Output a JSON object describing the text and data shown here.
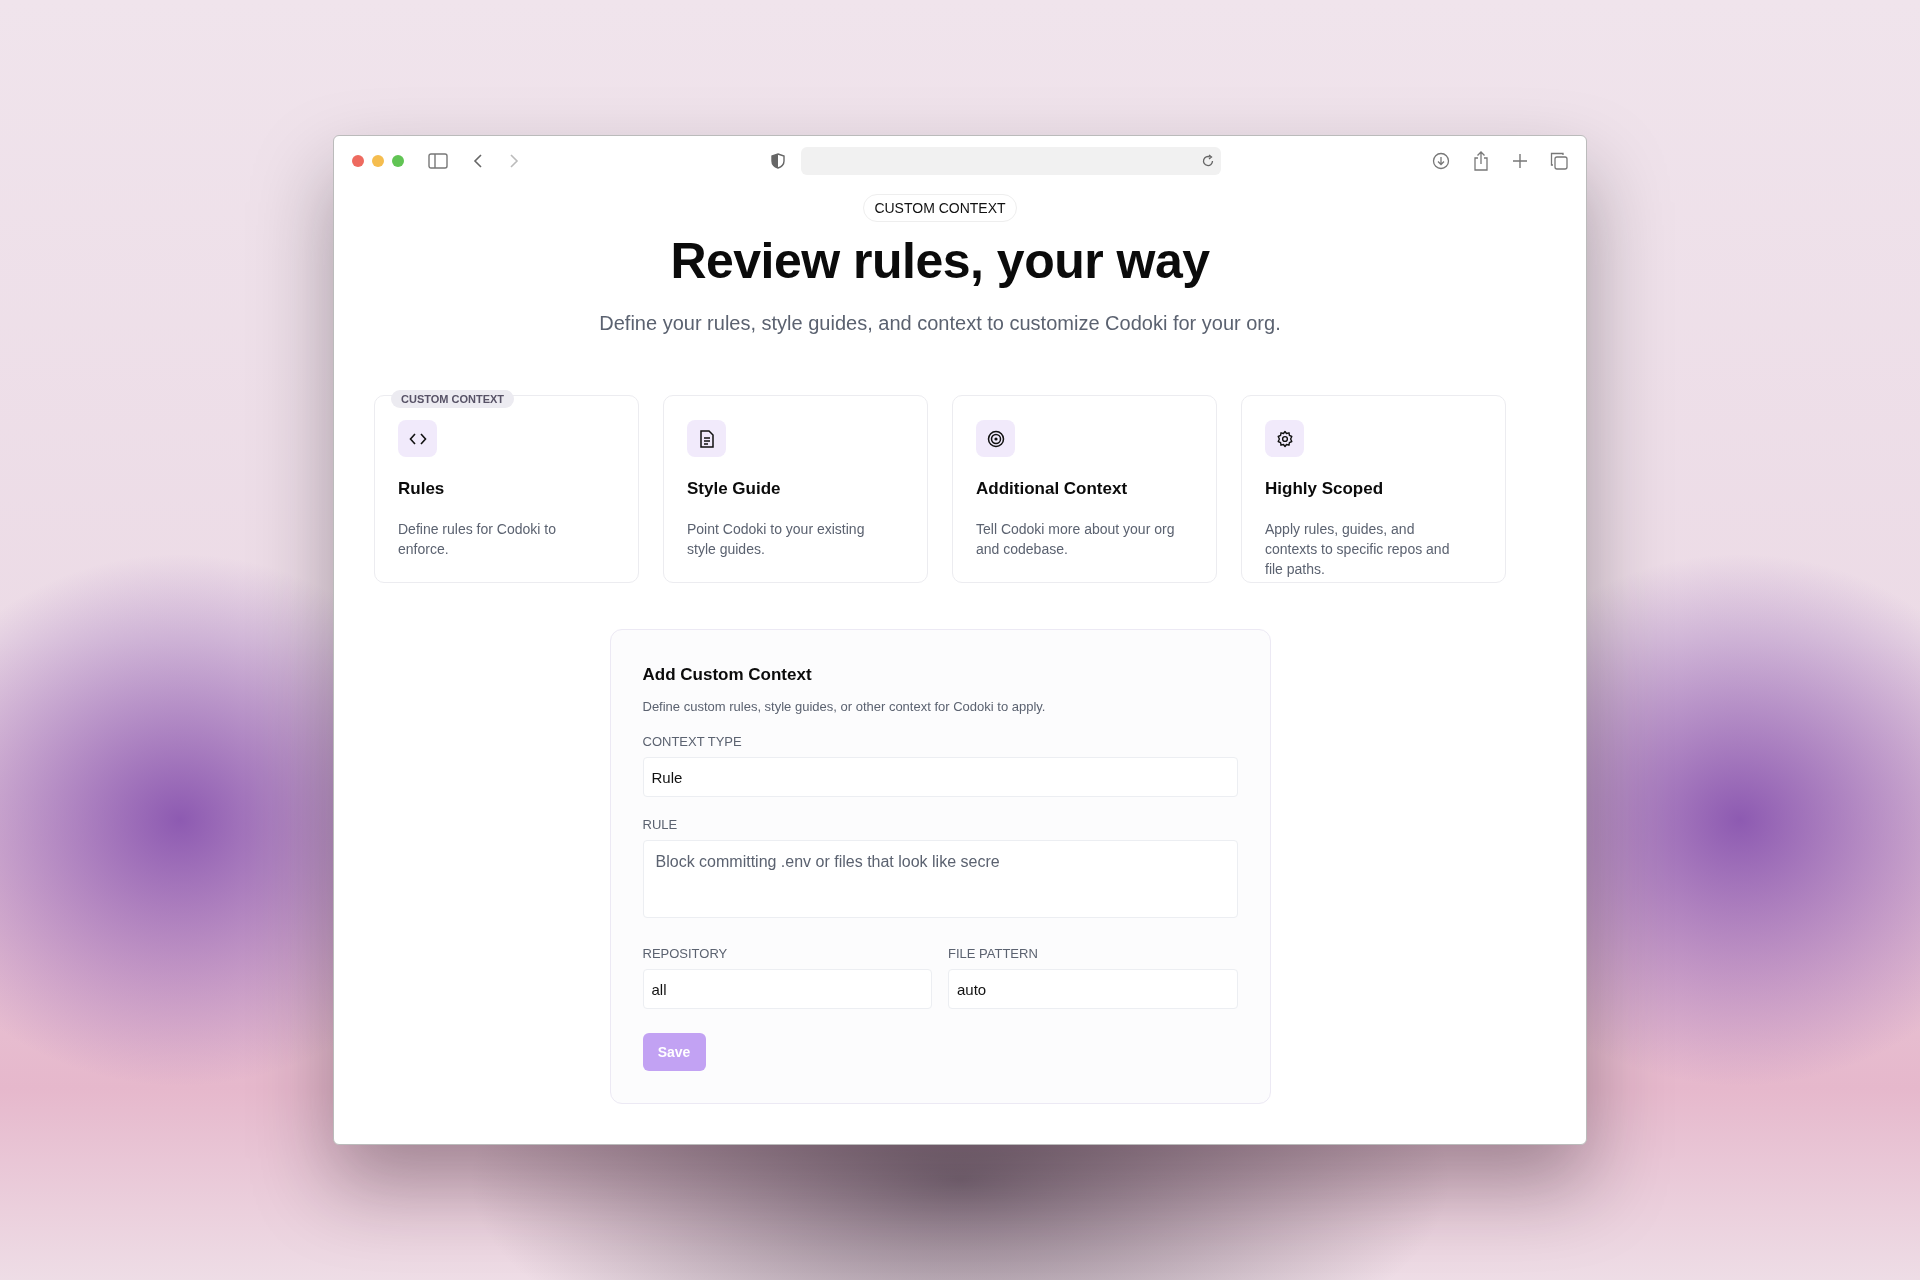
{
  "hero": {
    "badge": "CUSTOM CONTEXT",
    "title": "Review rules, your way",
    "subtitle": "Define your rules, style guides, and context to customize Codoki for your org."
  },
  "features": [
    {
      "badge": "CUSTOM CONTEXT",
      "title": "Rules",
      "text": "Define rules for Codoki to enforce."
    },
    {
      "title": "Style Guide",
      "text": "Point Codoki to your existing style guides."
    },
    {
      "title": "Additional Context",
      "text": "Tell Codoki more about your org and codebase."
    },
    {
      "title": "Highly Scoped",
      "text": "Apply rules, guides, and contexts to specific repos and file paths."
    }
  ],
  "form": {
    "title": "Add Custom Context",
    "description": "Define custom rules, style guides, or other context for Codoki to apply.",
    "context_type": {
      "label": "CONTEXT TYPE",
      "value": "Rule"
    },
    "rule": {
      "label": "RULE",
      "value": "Block committing .env or files that look like secre"
    },
    "repository": {
      "label": "REPOSITORY",
      "value": "all"
    },
    "file_pattern": {
      "label": "FILE PATTERN",
      "value": "auto"
    },
    "save_button": {
      "label": "Save",
      "disabled": true
    }
  }
}
